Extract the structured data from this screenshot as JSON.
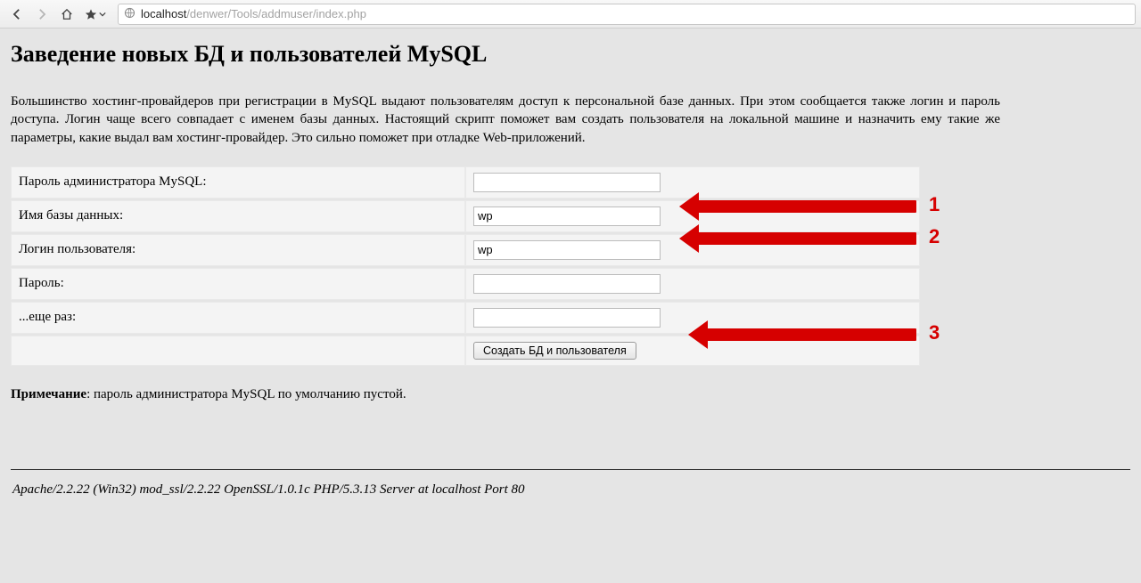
{
  "url": {
    "host": "localhost",
    "rest": "/denwer/Tools/addmuser/index.php"
  },
  "page": {
    "title": "Заведение новых БД и пользователей MySQL",
    "intro": "Большинство хостинг-провайдеров при регистрации в MySQL выдают пользователям доступ к персональной базе данных. При этом сообщается также логин и пароль доступа. Логин чаще всего совпадает с именем базы данных. Настоящий скрипт поможет вам создать пользователя на локальной машине и назначить ему такие же параметры, какие выдал вам хостинг-провайдер. Это сильно поможет при отладке Web-приложений."
  },
  "form": {
    "rows": [
      {
        "label": "Пароль администратора MySQL:",
        "value": "",
        "type": "password"
      },
      {
        "label": "Имя базы данных:",
        "value": "wp",
        "type": "text"
      },
      {
        "label": "Логин пользователя:",
        "value": "wp",
        "type": "text"
      },
      {
        "label": "Пароль:",
        "value": "",
        "type": "password"
      },
      {
        "label": "...еще раз:",
        "value": "",
        "type": "password"
      }
    ],
    "submit_label": "Создать БД и пользователя"
  },
  "note": {
    "prefix": "Примечание",
    "text": ": пароль администратора MySQL по умолчанию пустой."
  },
  "footer": "Apache/2.2.22 (Win32) mod_ssl/2.2.22 OpenSSL/1.0.1c PHP/5.3.13 Server at localhost Port 80",
  "annotations": [
    {
      "num": "1"
    },
    {
      "num": "2"
    },
    {
      "num": "3"
    }
  ]
}
